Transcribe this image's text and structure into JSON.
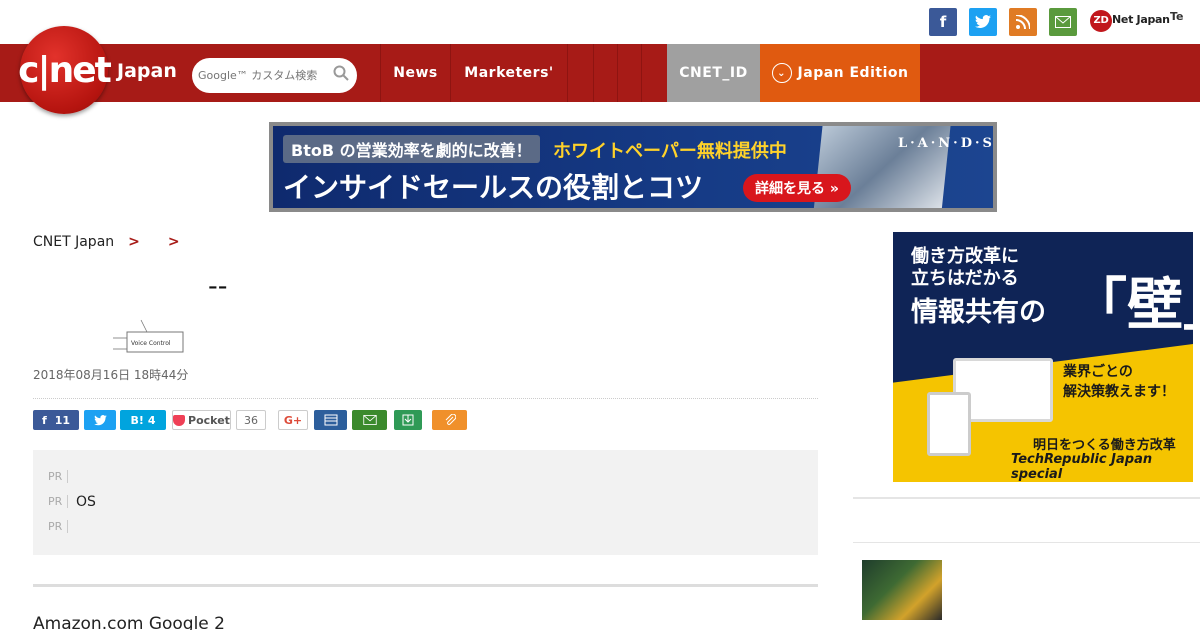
{
  "colors": {
    "brand_red": "#a71b17",
    "facebook": "#3b5998",
    "twitter": "#1da1f2",
    "rss": "#e07b24",
    "mail": "#5a9a3d",
    "cnet_id_bg": "#a0a0a0",
    "edition_bg": "#e05a10",
    "pocket": "#ef4056",
    "hatena": "#00a4de"
  },
  "topbar": {
    "icons": [
      "facebook-icon",
      "twitter-icon",
      "rss-icon",
      "mail-icon"
    ],
    "zdnet_label": "Net Japan",
    "zdnet_badge": "ZD",
    "te_label": "Te"
  },
  "header": {
    "logo_text": "c|net",
    "logo_sub": "Japan",
    "search_placeholder": "Google™ カスタム検索"
  },
  "nav": {
    "items": [
      "News",
      "Marketers'",
      "",
      "",
      ""
    ],
    "cnet_id": "CNET_ID",
    "edition": "Japan Edition"
  },
  "banner": {
    "tag": "BtoB の営業効率を劇的に改善！",
    "tag2": "ホワイトペーパー無料提供中",
    "headline": "インサイドセールスの役割とコツ",
    "button": "詳細を見る »",
    "brand": "L·A·N·D·S·C·A·P·E"
  },
  "breadcrumb": {
    "items": [
      "CNET Japan",
      "",
      ""
    ],
    "sep": ">"
  },
  "article": {
    "title": "--",
    "thumb_label": "Voice Control",
    "date": "2018年08月16日 18時44分",
    "body_fragment": "Amazon.com Google 2"
  },
  "share": {
    "facebook_count": "11",
    "hatena_count": "4",
    "hatena_label": "B!",
    "pocket_label": "Pocket",
    "pocket_count": "36",
    "gplus_label": "G+"
  },
  "pr": {
    "label": "PR",
    "items": [
      "",
      "OS",
      ""
    ]
  },
  "sidebar": {
    "ad": {
      "line1": "働き方改革に",
      "line2": "立ちはだかる",
      "line3": "情報共有の",
      "wall": "「壁」",
      "industry": "業界ごとの",
      "solve": "解決策教えます！",
      "tagline": "明日をつくる働き方改革",
      "special": "TechRepublic Japan special"
    },
    "section_title": "",
    "item_title": "",
    "item_sub": ""
  }
}
